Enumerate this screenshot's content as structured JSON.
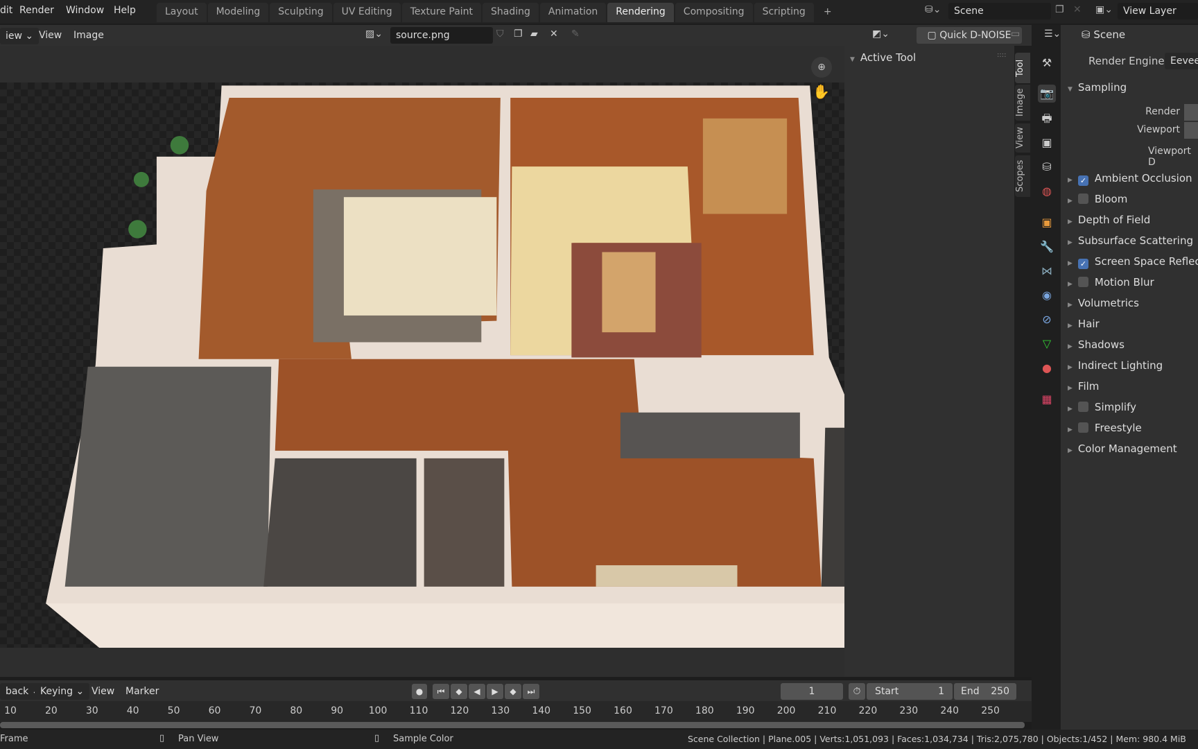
{
  "topbar": {
    "menus": [
      "dit",
      "Render",
      "Window",
      "Help"
    ],
    "workspaces": [
      "Layout",
      "Modeling",
      "Sculpting",
      "UV Editing",
      "Texture Paint",
      "Shading",
      "Animation",
      "Rendering",
      "Compositing",
      "Scripting"
    ],
    "active_workspace": "Rendering",
    "add_tab": "+",
    "scene": "Scene",
    "view_layer": "View Layer"
  },
  "image_editor": {
    "view_mode": "iew",
    "menus": [
      "View",
      "Image"
    ],
    "image_name": "source.png",
    "quick_denoise": "Quick D-NOISE",
    "n_panel": {
      "header": "Active Tool",
      "tabs": [
        "Tool",
        "Image",
        "View",
        "Scopes"
      ],
      "active_tab": "Tool"
    }
  },
  "properties": {
    "context": "Scene",
    "render_engine_label": "Render Engine",
    "render_engine": "Eevee",
    "sampling": {
      "title": "Sampling",
      "render_label": "Render",
      "viewport_label": "Viewport",
      "denoise_label": "Viewport D"
    },
    "panels": [
      {
        "label": "Ambient Occlusion",
        "checkbox": true
      },
      {
        "label": "Bloom",
        "checkbox": false
      },
      {
        "label": "Depth of Field"
      },
      {
        "label": "Subsurface Scattering"
      },
      {
        "label": "Screen Space Reflect",
        "checkbox": true
      },
      {
        "label": "Motion Blur",
        "checkbox": false
      },
      {
        "label": "Volumetrics"
      },
      {
        "label": "Hair"
      },
      {
        "label": "Shadows"
      },
      {
        "label": "Indirect Lighting"
      },
      {
        "label": "Film"
      },
      {
        "label": "Simplify",
        "checkbox": false
      },
      {
        "label": "Freestyle",
        "checkbox": false
      },
      {
        "label": "Color Management"
      }
    ]
  },
  "timeline": {
    "menus": [
      "back",
      "Keying",
      "View",
      "Marker"
    ],
    "current_frame": "1",
    "start_label": "Start",
    "start": "1",
    "end_label": "End",
    "end": "250",
    "ticks": [
      "10",
      "20",
      "30",
      "40",
      "50",
      "60",
      "70",
      "80",
      "90",
      "100",
      "110",
      "120",
      "130",
      "140",
      "150",
      "160",
      "170",
      "180",
      "190",
      "200",
      "210",
      "220",
      "230",
      "240",
      "250"
    ]
  },
  "status": {
    "left": "Frame",
    "pan": "Pan View",
    "sample": "Sample Color",
    "stats": "Scene Collection | Plane.005 | Verts:1,051,093 | Faces:1,034,734 | Tris:2,075,780 | Objects:1/452 | Mem: 980.4 MiB"
  },
  "colors": {
    "accent": "#4772b3",
    "active_tab": "#3d3d3d"
  }
}
